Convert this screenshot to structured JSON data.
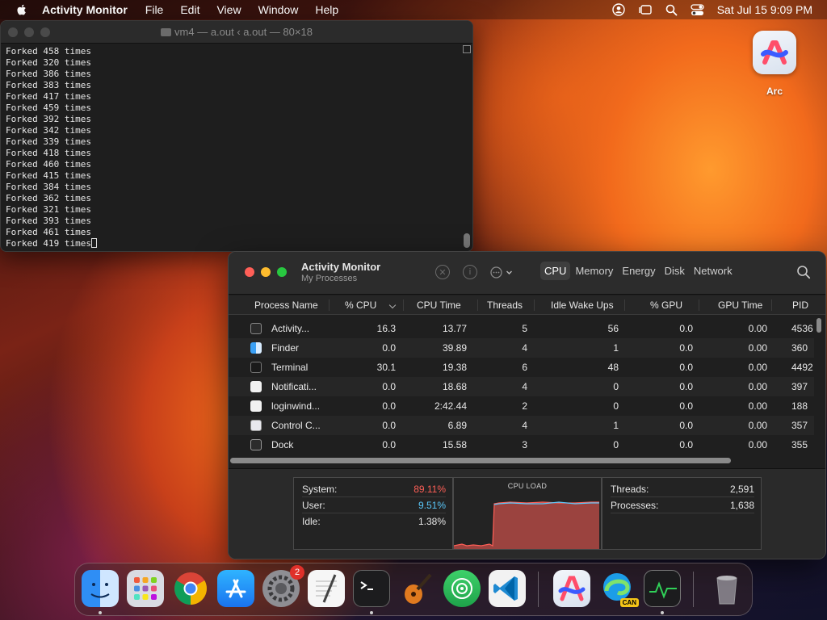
{
  "menubar": {
    "app_name": "Activity Monitor",
    "menus": [
      "File",
      "Edit",
      "View",
      "Window",
      "Help"
    ],
    "clock": "Sat Jul 15  9:09 PM"
  },
  "terminal": {
    "title": "vm4 — a.out ‹ a.out — 80×18",
    "lines": [
      "Forked 458 times",
      "Forked 320 times",
      "Forked 386 times",
      "Forked 383 times",
      "Forked 417 times",
      "Forked 459 times",
      "Forked 392 times",
      "Forked 342 times",
      "Forked 339 times",
      "Forked 418 times",
      "Forked 460 times",
      "Forked 415 times",
      "Forked 384 times",
      "Forked 362 times",
      "Forked 321 times",
      "Forked 393 times",
      "Forked 461 times",
      "Forked 419 times"
    ]
  },
  "desktop": {
    "arc_label": "Arc"
  },
  "activity_monitor": {
    "title": "Activity Monitor",
    "subtitle": "My Processes",
    "tabs": [
      "CPU",
      "Memory",
      "Energy",
      "Disk",
      "Network"
    ],
    "active_tab": "CPU",
    "columns": [
      "Process Name",
      "% CPU",
      "CPU Time",
      "Threads",
      "Idle Wake Ups",
      "% GPU",
      "GPU Time",
      "PID"
    ],
    "rows": [
      {
        "name": "Activity...",
        "cpu": "16.3",
        "cpu_time": "13.77",
        "threads": "5",
        "idle": "56",
        "gpu": "0.0",
        "gpu_time": "0.00",
        "pid": "4536",
        "icon": "activity-monitor-icon"
      },
      {
        "name": "Finder",
        "cpu": "0.0",
        "cpu_time": "39.89",
        "threads": "4",
        "idle": "1",
        "gpu": "0.0",
        "gpu_time": "0.00",
        "pid": "360",
        "icon": "finder-icon"
      },
      {
        "name": "Terminal",
        "cpu": "30.1",
        "cpu_time": "19.38",
        "threads": "6",
        "idle": "48",
        "gpu": "0.0",
        "gpu_time": "0.00",
        "pid": "4492",
        "icon": "terminal-icon"
      },
      {
        "name": "Notificati...",
        "cpu": "0.0",
        "cpu_time": "18.68",
        "threads": "4",
        "idle": "0",
        "gpu": "0.0",
        "gpu_time": "0.00",
        "pid": "397",
        "icon": "generic-app-icon"
      },
      {
        "name": "loginwind...",
        "cpu": "0.0",
        "cpu_time": "2:42.44",
        "threads": "2",
        "idle": "0",
        "gpu": "0.0",
        "gpu_time": "0.00",
        "pid": "188",
        "icon": "generic-app-icon"
      },
      {
        "name": "Control C...",
        "cpu": "0.0",
        "cpu_time": "6.89",
        "threads": "4",
        "idle": "1",
        "gpu": "0.0",
        "gpu_time": "0.00",
        "pid": "357",
        "icon": "control-center-icon"
      },
      {
        "name": "Dock",
        "cpu": "0.0",
        "cpu_time": "15.58",
        "threads": "3",
        "idle": "0",
        "gpu": "0.0",
        "gpu_time": "0.00",
        "pid": "355",
        "icon": "dock-icon"
      }
    ],
    "summary": {
      "system_label": "System:",
      "system_value": "89.11%",
      "user_label": "User:",
      "user_value": "9.51%",
      "idle_label": "Idle:",
      "idle_value": "1.38%",
      "chart_title": "CPU LOAD",
      "threads_label": "Threads:",
      "threads_value": "2,591",
      "processes_label": "Processes:",
      "processes_value": "1,638"
    },
    "colors": {
      "system": "#ff5f57",
      "user": "#5ac8fa"
    }
  },
  "dock": {
    "apps": [
      "finder",
      "launchpad",
      "chrome",
      "app-store",
      "system-settings",
      "textedit",
      "terminal",
      "garageband",
      "find-my",
      "vscode",
      "arc",
      "edge-canary",
      "activity-monitor",
      "trash"
    ],
    "settings_badge": "2",
    "edge_badge": "CAN"
  }
}
